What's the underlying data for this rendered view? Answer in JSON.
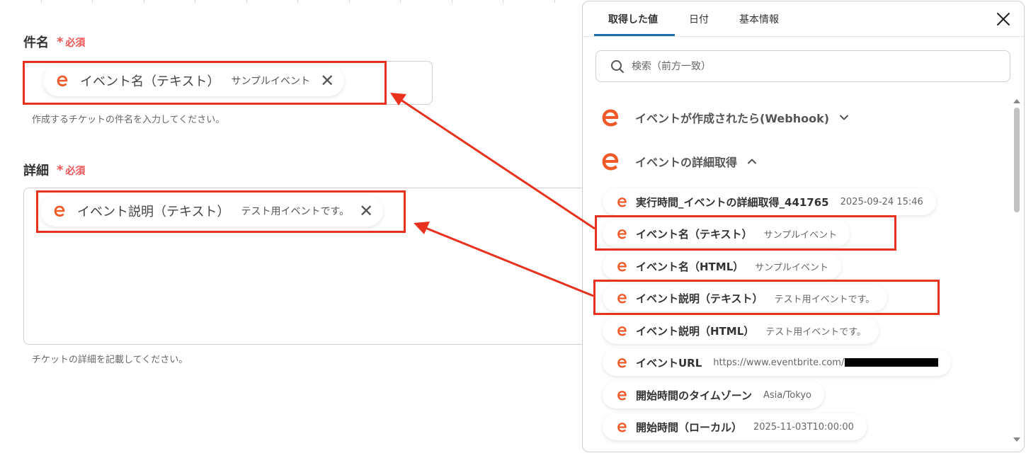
{
  "form": {
    "subject": {
      "label": "件名",
      "required": "必須",
      "chip_name": "イベント名（テキスト）",
      "chip_value": "サンプルイベント",
      "help": "作成するチケットの件名を入力してください。"
    },
    "detail": {
      "label": "詳細",
      "required": "必須",
      "chip_name": "イベント説明（テキスト）",
      "chip_value": "テスト用イベントです。",
      "help": "チケットの詳細を記載してください。"
    },
    "required_mark": "*",
    "remove_glyph": "✕"
  },
  "panel": {
    "tabs": [
      {
        "label": "取得した値",
        "active": true
      },
      {
        "label": "日付",
        "active": false
      },
      {
        "label": "基本情報",
        "active": false
      }
    ],
    "search_placeholder": "検索（前方一致）",
    "groups": [
      {
        "title": "イベントが作成されたら(Webhook)",
        "expanded": false
      },
      {
        "title": "イベントの詳細取得",
        "expanded": true
      }
    ],
    "items": [
      {
        "name": "実行時間_イベントの詳細取得_441765",
        "value": "2025-09-24 15:46"
      },
      {
        "name": "イベント名（テキスト）",
        "value": "サンプルイベント"
      },
      {
        "name": "イベント名（HTML）",
        "value": "サンプルイベント"
      },
      {
        "name": "イベント説明（テキスト）",
        "value": "テスト用イベントです。"
      },
      {
        "name": "イベント説明（HTML）",
        "value": "テスト用イベントです。"
      },
      {
        "name": "イベントURL",
        "value": "https://www.eventbrite.com/"
      },
      {
        "name": "開始時間のタイムゾーン",
        "value": "Asia/Tokyo"
      },
      {
        "name": "開始時間（ローカル）",
        "value": "2025-11-03T10:00:00"
      }
    ]
  },
  "colors": {
    "accent_orange": "#f05a28",
    "highlight_red": "#e8321e",
    "required_red": "#f05454",
    "tab_underline": "#1e6fae"
  },
  "icons": {
    "service_logo": "eventbrite-e-icon",
    "search": "search-icon",
    "close": "close-icon",
    "expand": "chevron-down-icon",
    "collapse": "chevron-up-icon"
  }
}
